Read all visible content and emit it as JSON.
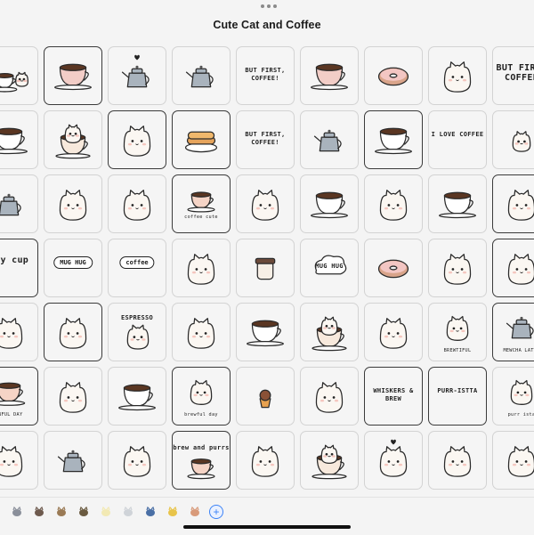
{
  "window": {
    "title": "Cute Cat and Coffee"
  },
  "grid": {
    "rows": [
      [
        {
          "id": "r1c1",
          "kind": "cup-cat"
        },
        {
          "id": "r1c2",
          "kind": "mug",
          "selected": true
        },
        {
          "id": "r1c3",
          "kind": "pot",
          "heart": true
        },
        {
          "id": "r1c4",
          "kind": "pot"
        },
        {
          "id": "r1c5",
          "kind": "text",
          "caption": "BUT FIRST, COFFEE!"
        },
        {
          "id": "r1c6",
          "kind": "mug"
        },
        {
          "id": "r1c7",
          "kind": "donut"
        },
        {
          "id": "r1c8",
          "kind": "cat"
        },
        {
          "id": "r1c9",
          "kind": "text-big",
          "caption": "BUT FIRST COFFEE"
        }
      ],
      [
        {
          "id": "r2c1",
          "kind": "cup"
        },
        {
          "id": "r2c2",
          "kind": "cat-cup"
        },
        {
          "id": "r2c3",
          "kind": "cat",
          "selected": true
        },
        {
          "id": "r2c4",
          "kind": "pancakes",
          "selected": true
        },
        {
          "id": "r2c5",
          "kind": "text",
          "caption": "BUT FIRST, COFFEE!"
        },
        {
          "id": "r2c6",
          "kind": "pot"
        },
        {
          "id": "r2c7",
          "kind": "cup",
          "selected": true
        },
        {
          "id": "r2c8",
          "kind": "text",
          "caption": "I LOVE COFFEE"
        },
        {
          "id": "r2c9",
          "kind": "cat-small"
        }
      ],
      [
        {
          "id": "r3c1",
          "kind": "pot"
        },
        {
          "id": "r3c2",
          "kind": "cat"
        },
        {
          "id": "r3c3",
          "kind": "cat"
        },
        {
          "id": "r3c4",
          "kind": "cup-caption",
          "caption": "coffee cute",
          "selected": true
        },
        {
          "id": "r3c5",
          "kind": "cat"
        },
        {
          "id": "r3c6",
          "kind": "cup"
        },
        {
          "id": "r3c7",
          "kind": "cat"
        },
        {
          "id": "r3c8",
          "kind": "cup"
        },
        {
          "id": "r3c9",
          "kind": "cat",
          "selected": true
        }
      ],
      [
        {
          "id": "r4c1",
          "kind": "text-big",
          "caption": "ozy cup",
          "selected": true
        },
        {
          "id": "r4c2",
          "kind": "bubble",
          "caption": "MUG HUG"
        },
        {
          "id": "r4c3",
          "kind": "bubble",
          "caption": "coffee"
        },
        {
          "id": "r4c4",
          "kind": "cat"
        },
        {
          "id": "r4c5",
          "kind": "jar"
        },
        {
          "id": "r4c6",
          "kind": "cloud-text",
          "caption": "MUG HUG"
        },
        {
          "id": "r4c7",
          "kind": "donut"
        },
        {
          "id": "r4c8",
          "kind": "cat"
        },
        {
          "id": "r4c9",
          "kind": "cat",
          "selected": true
        }
      ],
      [
        {
          "id": "r5c1",
          "kind": "cat"
        },
        {
          "id": "r5c2",
          "kind": "cat",
          "selected": true
        },
        {
          "id": "r5c3",
          "kind": "cat-caption",
          "caption": "ESPRESSO"
        },
        {
          "id": "r5c4",
          "kind": "cat"
        },
        {
          "id": "r5c5",
          "kind": "cup"
        },
        {
          "id": "r5c6",
          "kind": "cat-cup"
        },
        {
          "id": "r5c7",
          "kind": "cat"
        },
        {
          "id": "r5c8",
          "kind": "cat-bottom",
          "caption": "BREWTIFUL"
        },
        {
          "id": "r5c9",
          "kind": "pot-bottom",
          "caption": "MEWCHA LATTE",
          "selected": true
        }
      ],
      [
        {
          "id": "r6c1",
          "kind": "cup-bottom",
          "caption": "EWFUL DAY",
          "selected": true
        },
        {
          "id": "r6c2",
          "kind": "cat"
        },
        {
          "id": "r6c3",
          "kind": "cup"
        },
        {
          "id": "r6c4",
          "kind": "cat-bottom",
          "caption": "brewful day",
          "selected": true
        },
        {
          "id": "r6c5",
          "kind": "cupcake"
        },
        {
          "id": "r6c6",
          "kind": "cat"
        },
        {
          "id": "r6c7",
          "kind": "text",
          "caption": "WHISKERS & BREW",
          "selected": true
        },
        {
          "id": "r6c8",
          "kind": "text",
          "caption": "PURR-ISTTA",
          "selected": true
        },
        {
          "id": "r6c9",
          "kind": "cat-bottom",
          "caption": "purr ista"
        }
      ],
      [
        {
          "id": "r7c1",
          "kind": "cat"
        },
        {
          "id": "r7c2",
          "kind": "pot"
        },
        {
          "id": "r7c3",
          "kind": "cat"
        },
        {
          "id": "r7c4",
          "kind": "cup-top",
          "caption": "brew and purrs",
          "selected": true
        },
        {
          "id": "r7c5",
          "kind": "cat"
        },
        {
          "id": "r7c6",
          "kind": "cat-cup"
        },
        {
          "id": "r7c7",
          "kind": "cat",
          "heart": true
        },
        {
          "id": "r7c8",
          "kind": "cat"
        },
        {
          "id": "r7c9",
          "kind": "cat"
        }
      ]
    ]
  },
  "toolbar": {
    "items": [
      {
        "name": "cat-thumb-icon",
        "color": "#8a8f9a"
      },
      {
        "name": "pot-thumb-icon",
        "color": "#6e5a4e"
      },
      {
        "name": "cat-thumb-icon",
        "color": "#9a7a55"
      },
      {
        "name": "pot-thumb-icon",
        "color": "#6a5a40"
      },
      {
        "name": "cat-thumb-icon",
        "color": "#f2e9b4"
      },
      {
        "name": "cloud-thumb-icon",
        "color": "#cfd3d8"
      },
      {
        "name": "pen-thumb-icon",
        "color": "#4a6fa5"
      },
      {
        "name": "smiley-thumb-icon",
        "color": "#e8c44a"
      },
      {
        "name": "cookie-thumb-icon",
        "color": "#d89a7a"
      }
    ],
    "add_label": "+"
  }
}
